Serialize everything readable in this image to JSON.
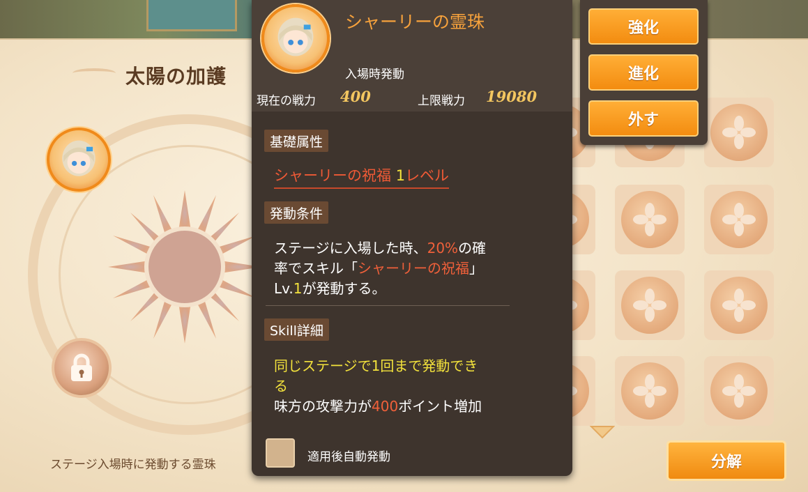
{
  "panel": {
    "title": "太陽の加護",
    "hint": "ステージ入場時に発動する霊珠"
  },
  "tooltip": {
    "title": "シャーリーの霊珠",
    "trigger": "入場時発動",
    "current_power_label": "現在の戦力",
    "current_power_value": "400",
    "max_power_label": "上限戦力",
    "max_power_value": "19080",
    "base_attr_heading": "基礎属性",
    "base_attr_name": "シャーリーの祝福 ",
    "base_attr_level_num": "1",
    "base_attr_level_unit": "レベル",
    "condition_heading": "発動条件",
    "condition": {
      "p1": "ステージに入場した時、",
      "chance": "20%",
      "p2": "の確",
      "p3": "率でスキル「",
      "skill": "シャーリーの祝福",
      "p4": "」",
      "p5": "Lv.",
      "lv": "1",
      "p6": "が発動する。"
    },
    "skill_heading": "Skill詳細",
    "skill_detail": {
      "line1": "同じステージで1回まで発動でき",
      "line2": "る",
      "p1": "味方の攻撃力が",
      "amount": "400",
      "p2": "ポイント増加"
    },
    "auto_label": "適用後自動発動"
  },
  "actions": {
    "enhance": "強化",
    "evolve": "進化",
    "remove": "外す"
  },
  "decompose_label": "分解",
  "colors": {
    "accent_orange": "#f38c10",
    "highlight_red": "#f0603a",
    "highlight_yellow": "#f3e23c",
    "tooltip_bg": "#3e342d"
  }
}
